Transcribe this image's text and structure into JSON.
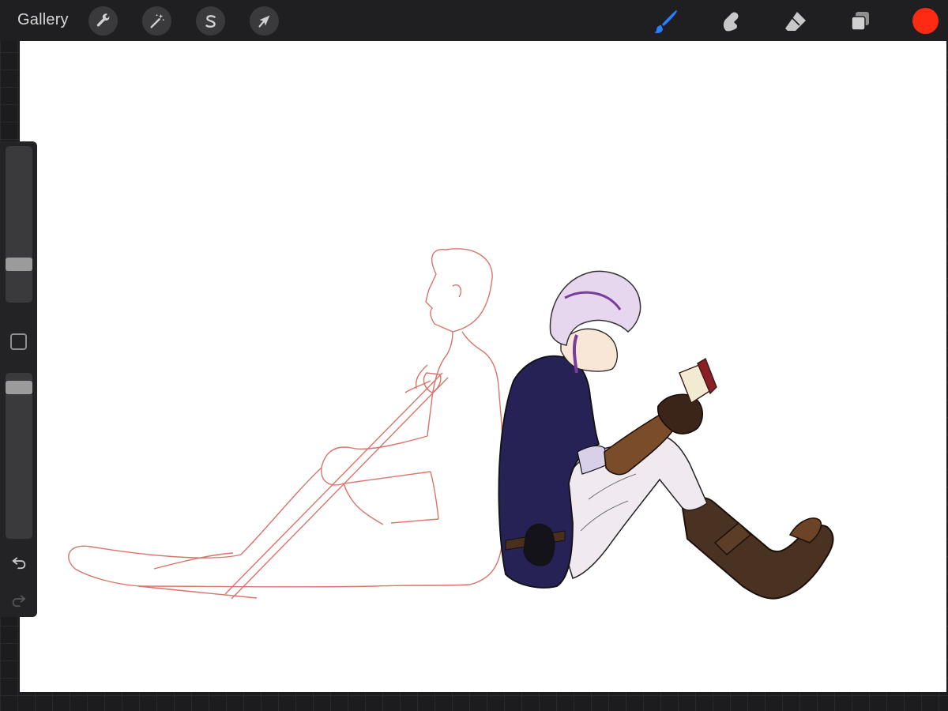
{
  "topbar": {
    "gallery_label": "Gallery",
    "left_tools": [
      {
        "name": "actions",
        "icon": "wrench-icon"
      },
      {
        "name": "adjustments",
        "icon": "magic-wand-icon"
      },
      {
        "name": "selection",
        "icon": "selection-s-icon"
      },
      {
        "name": "transform",
        "icon": "arrow-cursor-icon"
      }
    ],
    "right_tools": [
      {
        "name": "brush",
        "icon": "brush-icon",
        "active": true
      },
      {
        "name": "smudge",
        "icon": "smudge-finger-icon",
        "active": false
      },
      {
        "name": "eraser",
        "icon": "eraser-icon",
        "active": false
      },
      {
        "name": "layers",
        "icon": "layers-icon",
        "active": false
      }
    ],
    "current_color": "#ff2a14"
  },
  "sidebar": {
    "brush_size_level": 0.22,
    "opacity_level": 0.95,
    "modify_icon": "square-modify-icon",
    "undo_icon": "undo-arrow-icon",
    "redo_icon": "redo-arrow-icon"
  },
  "colors": {
    "active_tool": "#2a7fff",
    "icon_default": "#c8c8c8",
    "sketch_line": "#d9746a",
    "shirt": "#262255",
    "pants": "#f1e9f0",
    "leather": "#5a3a22",
    "hair": "#e6d6ee"
  }
}
